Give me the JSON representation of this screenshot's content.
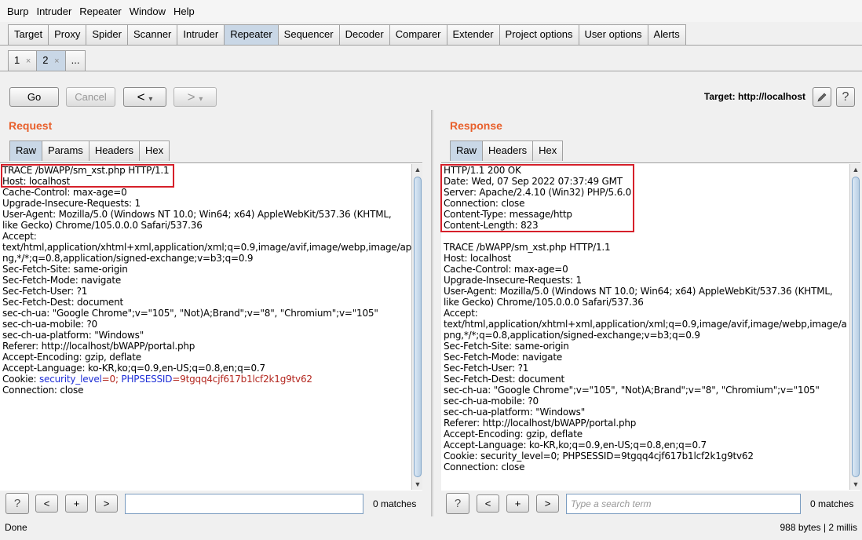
{
  "menu": [
    "Burp",
    "Intruder",
    "Repeater",
    "Window",
    "Help"
  ],
  "main_tabs": [
    "Target",
    "Proxy",
    "Spider",
    "Scanner",
    "Intruder",
    "Repeater",
    "Sequencer",
    "Decoder",
    "Comparer",
    "Extender",
    "Project options",
    "User options",
    "Alerts"
  ],
  "sub_tabs": [
    {
      "label": "1",
      "close": "×"
    },
    {
      "label": "2",
      "close": "×"
    },
    {
      "label": "..."
    }
  ],
  "toolbar": {
    "go": "Go",
    "cancel": "Cancel",
    "back": "<",
    "fwd": ">",
    "dropdown": "▾",
    "target": "Target: http://localhost",
    "help": "?"
  },
  "request": {
    "title": "Request",
    "tabs": [
      "Raw",
      "Params",
      "Headers",
      "Hex"
    ],
    "lines": [
      "TRACE /bWAPP/sm_xst.php HTTP/1.1",
      "Host: localhost",
      "Cache-Control: max-age=0",
      "Upgrade-Insecure-Requests: 1",
      "User-Agent: Mozilla/5.0 (Windows NT 10.0; Win64; x64) AppleWebKit/537.36 (KHTML,",
      "like Gecko) Chrome/105.0.0.0 Safari/537.36",
      "Accept:",
      "text/html,application/xhtml+xml,application/xml;q=0.9,image/avif,image/webp,image/ap",
      "ng,*/*;q=0.8,application/signed-exchange;v=b3;q=0.9",
      "Sec-Fetch-Site: same-origin",
      "Sec-Fetch-Mode: navigate",
      "Sec-Fetch-User: ?1",
      "Sec-Fetch-Dest: document",
      "sec-ch-ua: \"Google Chrome\";v=\"105\", \"Not)A;Brand\";v=\"8\", \"Chromium\";v=\"105\"",
      "sec-ch-ua-mobile: ?0",
      "sec-ch-ua-platform: \"Windows\"",
      "Referer: http://localhost/bWAPP/portal.php",
      "Accept-Encoding: gzip, deflate",
      "Accept-Language: ko-KR,ko;q=0.9,en-US;q=0.8,en;q=0.7"
    ],
    "cookie": {
      "prefix": "Cookie: ",
      "k1": "security_level",
      "v1": "=0; ",
      "k2": "PHPSESSID",
      "v2": "=9tgqq4cjf617b1lcf2k1g9tv62"
    },
    "last_line": "Connection: close",
    "search_placeholder": "",
    "matches": "0 matches"
  },
  "response": {
    "title": "Response",
    "tabs": [
      "Raw",
      "Headers",
      "Hex"
    ],
    "lines": [
      "HTTP/1.1 200 OK",
      "Date: Wed, 07 Sep 2022 07:37:49 GMT",
      "Server: Apache/2.4.10 (Win32) PHP/5.6.0",
      "Connection: close",
      "Content-Type: message/http",
      "Content-Length: 823",
      "",
      "TRACE /bWAPP/sm_xst.php HTTP/1.1",
      "Host: localhost",
      "Cache-Control: max-age=0",
      "Upgrade-Insecure-Requests: 1",
      "User-Agent: Mozilla/5.0 (Windows NT 10.0; Win64; x64) AppleWebKit/537.36 (KHTML,",
      "like Gecko) Chrome/105.0.0.0 Safari/537.36",
      "Accept:",
      "text/html,application/xhtml+xml,application/xml;q=0.9,image/avif,image/webp,image/a",
      "png,*/*;q=0.8,application/signed-exchange;v=b3;q=0.9",
      "Sec-Fetch-Site: same-origin",
      "Sec-Fetch-Mode: navigate",
      "Sec-Fetch-User: ?1",
      "Sec-Fetch-Dest: document",
      "sec-ch-ua: \"Google Chrome\";v=\"105\", \"Not)A;Brand\";v=\"8\", \"Chromium\";v=\"105\"",
      "sec-ch-ua-mobile: ?0",
      "sec-ch-ua-platform: \"Windows\"",
      "Referer: http://localhost/bWAPP/portal.php",
      "Accept-Encoding: gzip, deflate",
      "Accept-Language: ko-KR,ko;q=0.9,en-US;q=0.8,en;q=0.7",
      "Cookie: security_level=0; PHPSESSID=9tgqq4cjf617b1lcf2k1g9tv62",
      "Connection: close"
    ],
    "search_placeholder": "Type a search term",
    "matches": "0 matches"
  },
  "search_buttons": {
    "help": "?",
    "prev": "<",
    "add": "+",
    "next": ">"
  },
  "status": {
    "left": "Done",
    "right": "988 bytes | 2 millis"
  },
  "colors": {
    "section_title": "#e8602c",
    "highlight_box": "#d6202a",
    "cookie_key": "#1f2fd6",
    "cookie_value": "#b3261e"
  }
}
